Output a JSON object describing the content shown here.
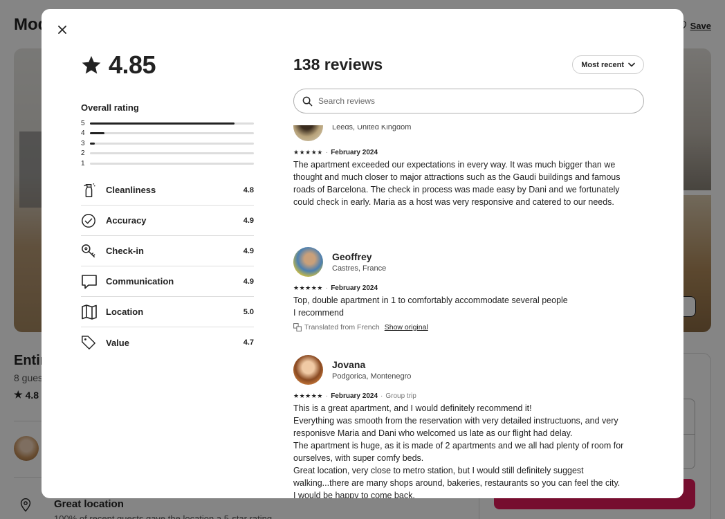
{
  "background": {
    "title": "Mod",
    "save_label": "Save",
    "entire": "Entir",
    "guests": "8 gues",
    "rating": "4.8",
    "location_title": "Great location",
    "location_sub": "100% of recent guests gave the location a 5-star rating"
  },
  "modal": {
    "overall": {
      "score": "4.85",
      "label": "Overall rating",
      "histogram": [
        {
          "label": "5",
          "fraction": 0.88
        },
        {
          "label": "4",
          "fraction": 0.09
        },
        {
          "label": "3",
          "fraction": 0.03
        },
        {
          "label": "2",
          "fraction": 0.0
        },
        {
          "label": "1",
          "fraction": 0.0
        }
      ]
    },
    "categories": [
      {
        "name": "Cleanliness",
        "value": "4.8",
        "icon": "spray-bottle-icon"
      },
      {
        "name": "Accuracy",
        "value": "4.9",
        "icon": "check-circle-icon"
      },
      {
        "name": "Check-in",
        "value": "4.9",
        "icon": "key-icon"
      },
      {
        "name": "Communication",
        "value": "4.9",
        "icon": "chat-bubble-icon"
      },
      {
        "name": "Location",
        "value": "5.0",
        "icon": "map-icon"
      },
      {
        "name": "Value",
        "value": "4.7",
        "icon": "tag-icon"
      }
    ],
    "reviews_title": "138 reviews",
    "sort_label": "Most recent",
    "search_placeholder": "Search reviews",
    "reviews": [
      {
        "name": "",
        "location": "Leeds, United Kingdom",
        "stars": "★★★★★",
        "date": "February 2024",
        "trip": "",
        "lines": [
          "The apartment exceeded our expectations in every way. It was much bigger than we",
          "thought and much closer to major attractions such as the Gaudi buildings and famous",
          "roads of Barcelona. The check in process was made easy by Dani and we fortunately",
          "could check in early. Maria as a host was very responsive and catered to our needs."
        ]
      },
      {
        "name": "Geoffrey",
        "location": "Castres, France",
        "stars": "★★★★★",
        "date": "February 2024",
        "trip": "",
        "lines": [
          "Top, double apartment in 1 to comfortably accommodate several people",
          "I recommend"
        ],
        "translated": "Translated from French",
        "show_original": "Show original"
      },
      {
        "name": "Jovana",
        "location": "Podgorica, Montenegro",
        "stars": "★★★★★",
        "date": "February 2024",
        "trip": "Group trip",
        "lines": [
          "This is a great apartment, and I would definitely recommend it!",
          "Everything was smooth from the reservation with very detailed instructuons, and very",
          "responisve Maria and Dani who welcomed us late as our flight had delay.",
          "The apartment is huge, as it is made of 2 apartments and we all had plenty of room for",
          "ourselves, with super comfy beds.",
          "Great location, very close to metro station, but I would still definitely suggest",
          "walking...there are many shops around, bakeries, restaurants so you can feel the city.",
          "I would be happy to come back."
        ]
      }
    ]
  }
}
